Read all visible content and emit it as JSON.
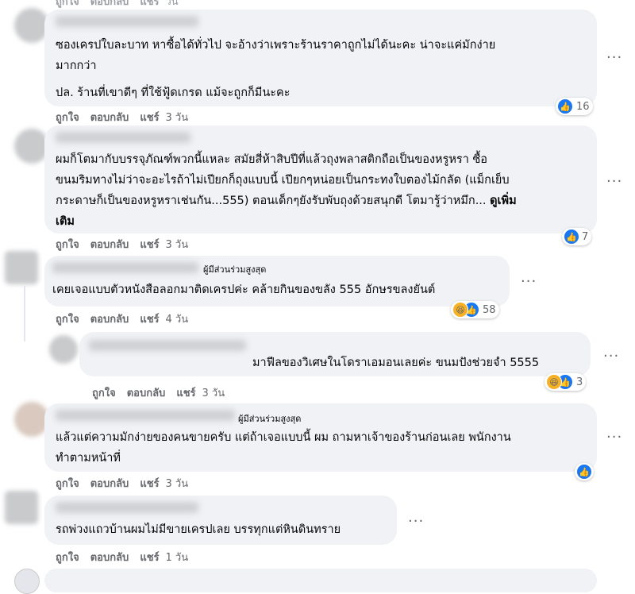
{
  "top_actions": {
    "like": "ถูกใจ",
    "reply": "ตอบกลับ",
    "share": "แชร์",
    "time": "วัน"
  },
  "comments": [
    {
      "line1": "ซองเครปใบละบาท หาซื้อได้ทั่วไป จะอ้างว่าเพราะร้านราคาถูกไม่ได้นะคะ น่าจะแค่มักง่าย",
      "line2": "มากกว่า",
      "line3": "ปล. ร้านที่เขาดีๆ ที่ใช้ฟู้ดเกรด แม้จะถูกก็มีนะคะ",
      "reactions": "16",
      "like": "ถูกใจ",
      "reply": "ตอบกลับ",
      "share": "แชร์",
      "time": "3 วัน"
    },
    {
      "line1": "ผมก็โตมากับบรรจุภัณฑ์พวกนี้แหละ สมัยสี่ห้าสิบปีที่แล้วถุงพลาสติกถือเป็นของหรูหรา ซื้อ",
      "line2": "ขนมริมทางไม่ว่าจะอะไรถ้าไม่เปียกก็ถุงแบบนี้ เปียกๆหน่อยเป็นกระทงใบตองไม้กลัด (แม็กเย็บ",
      "line3": "กระดาษก็เป็นของหรูหราเช่นกัน...555) ตอนเด็กๆยังรับพับถุงด้วยสนุกดี โตมารู้ว่าหมึก...",
      "see_more": "ดูเพิ่ม",
      "line4": "เติม",
      "reactions": "7",
      "like": "ถูกใจ",
      "reply": "ตอบกลับ",
      "share": "แชร์",
      "time": "3 วัน"
    },
    {
      "badge": "ผู้มีส่วนร่วมสูงสุด",
      "line1": "เคยเจอแบบตัวหนังสือลอกมาติดเครปค่ะ คล้ายกินของขลัง 555 อักษรขลงยันต์",
      "reactions": "58",
      "like": "ถูกใจ",
      "reply": "ตอบกลับ",
      "share": "แชร์",
      "time": "4 วัน"
    },
    {
      "line1": "มาฟีลของวิเศษในโดราเอมอนเลยค่ะ ขนมปังช่วยจำ 5555",
      "reactions": "3",
      "like": "ถูกใจ",
      "reply": "ตอบกลับ",
      "share": "แชร์",
      "time": "3 วัน"
    },
    {
      "badge": "ผู้มีส่วนร่วมสูงสุด",
      "line1": "แล้วแต่ความมักง่ายของคนขายครับ แต่ถ้าเจอแบบนี้ ผม ถามหาเจ้าของร้านก่อนเลย พนักงาน",
      "line2": "ทำตามหน้าที่",
      "like": "ถูกใจ",
      "reply": "ตอบกลับ",
      "share": "แชร์",
      "time": "3 วัน"
    },
    {
      "line1": "รถพ่วงแถวบ้านผมไม่มีขายเครปเลย บรรทุกแต่หินดินทราย",
      "like": "ถูกใจ",
      "reply": "ตอบกลับ",
      "share": "แชร์",
      "time": "1 วัน"
    }
  ],
  "icons": {
    "more": "more-horizontal-icon",
    "like": "like-icon",
    "haha": "haha-icon"
  }
}
